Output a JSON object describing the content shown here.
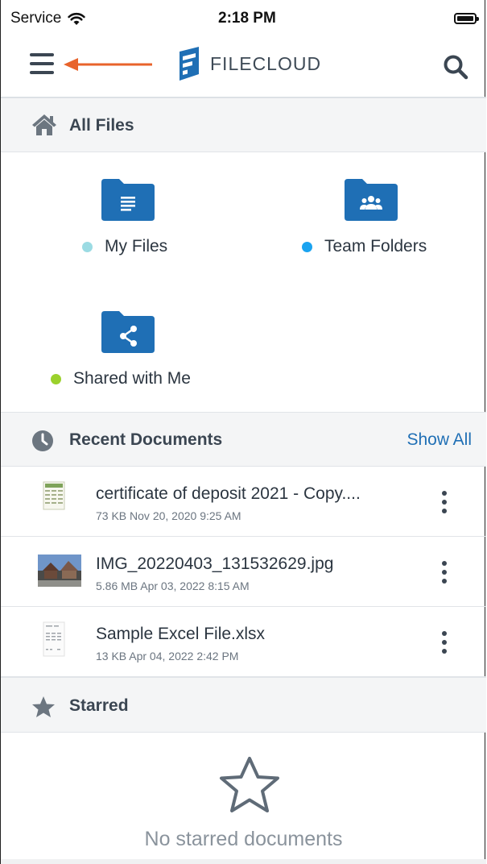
{
  "status_bar": {
    "carrier": "Service",
    "time": "2:18 PM"
  },
  "header": {
    "brand": "FILECLOUD"
  },
  "all_files": {
    "title": "All Files",
    "folders": [
      {
        "label": "My Files",
        "dot_color": "#9bdbe3"
      },
      {
        "label": "Team Folders",
        "dot_color": "#1aa3f0"
      },
      {
        "label": "Shared with Me",
        "dot_color": "#9bd12c"
      }
    ]
  },
  "recent": {
    "title": "Recent Documents",
    "show_all": "Show All",
    "items": [
      {
        "name": "certificate of deposit 2021 - Copy....",
        "meta": "73 KB Nov 20, 2020 9:25 AM"
      },
      {
        "name": "IMG_20220403_131532629.jpg",
        "meta": "5.86 MB Apr 03, 2022 8:15 AM"
      },
      {
        "name": "Sample Excel File.xlsx",
        "meta": "13 KB Apr 04, 2022 2:42 PM"
      }
    ]
  },
  "starred": {
    "title": "Starred",
    "empty_text": "No starred documents"
  },
  "colors": {
    "folder_blue": "#1f6fb5",
    "accent_link": "#1f6fb5",
    "arrow": "#e8632b"
  }
}
